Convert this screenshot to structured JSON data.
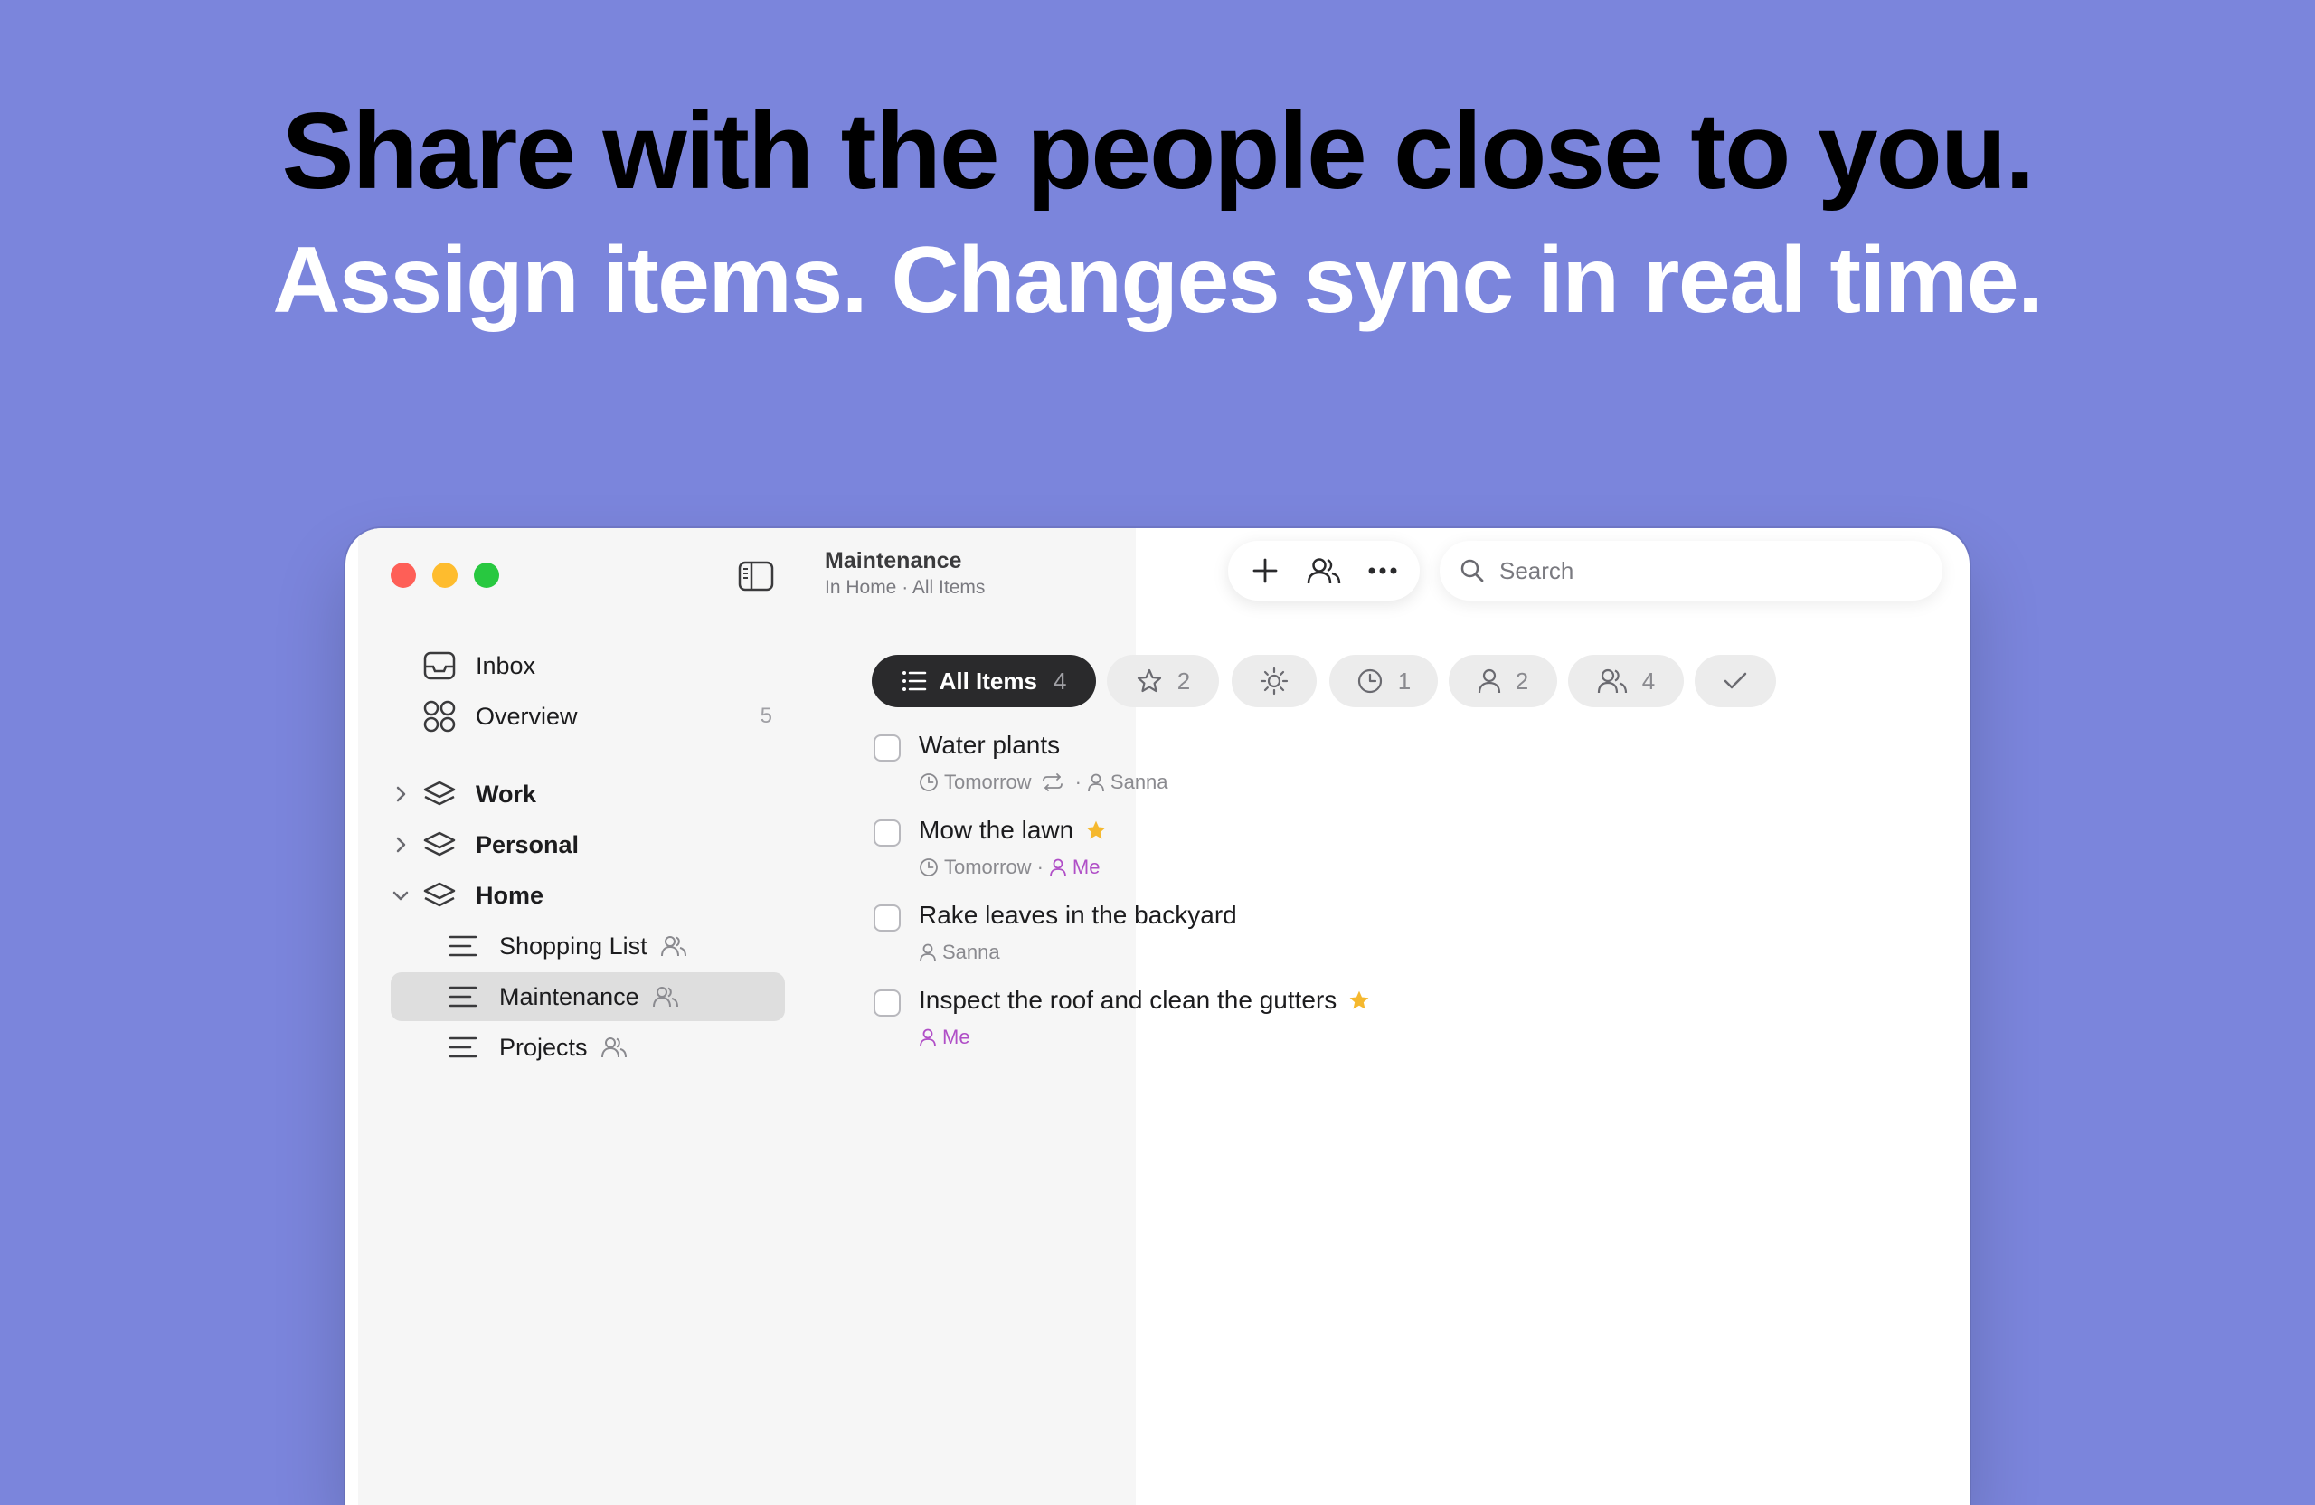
{
  "hero": {
    "title": "Share with the people close to you.",
    "subtitle": "Assign items. Changes sync in real time."
  },
  "window": {
    "title": "Maintenance",
    "subtitle": "In Home · All Items"
  },
  "sidebar": {
    "top_items": [
      {
        "label": "Inbox",
        "icon": "inbox-icon"
      },
      {
        "label": "Overview",
        "icon": "overview-icon",
        "count": "5"
      }
    ],
    "areas": [
      {
        "label": "Work",
        "expanded": false
      },
      {
        "label": "Personal",
        "expanded": false
      },
      {
        "label": "Home",
        "expanded": true
      }
    ],
    "lists": [
      {
        "label": "Shopping List",
        "shared": true
      },
      {
        "label": "Maintenance",
        "shared": true,
        "selected": true
      },
      {
        "label": "Projects",
        "shared": true
      }
    ]
  },
  "toolbar": {
    "add": "plus-icon",
    "share": "people-icon",
    "more": "more-icon"
  },
  "search": {
    "placeholder": "Search"
  },
  "filters": [
    {
      "label": "All Items",
      "count": "4",
      "icon": "list-icon",
      "active": true
    },
    {
      "label": "",
      "count": "2",
      "icon": "star-icon"
    },
    {
      "label": "",
      "count": "",
      "icon": "sun-icon"
    },
    {
      "label": "",
      "count": "1",
      "icon": "clock-icon"
    },
    {
      "label": "",
      "count": "2",
      "icon": "person-icon"
    },
    {
      "label": "",
      "count": "4",
      "icon": "people-icon"
    },
    {
      "label": "",
      "count": "",
      "icon": "checkmark-icon"
    }
  ],
  "tasks": [
    {
      "title": "Water plants",
      "starred": false,
      "due": "Tomorrow",
      "repeat": true,
      "assignee": "Sanna"
    },
    {
      "title": "Mow the lawn",
      "starred": true,
      "due": "Tomorrow",
      "repeat": false,
      "assignee": "Me"
    },
    {
      "title": "Rake leaves in the backyard",
      "starred": false,
      "due": "",
      "repeat": false,
      "assignee": "Sanna"
    },
    {
      "title": "Inspect the roof and clean the gutters",
      "starred": true,
      "due": "",
      "repeat": false,
      "assignee": "Me"
    }
  ],
  "colors": {
    "background": "#7b85dc",
    "me_accent": "#b04fc7",
    "star": "#f5b82e",
    "active_filter": "#2a2a2c"
  }
}
